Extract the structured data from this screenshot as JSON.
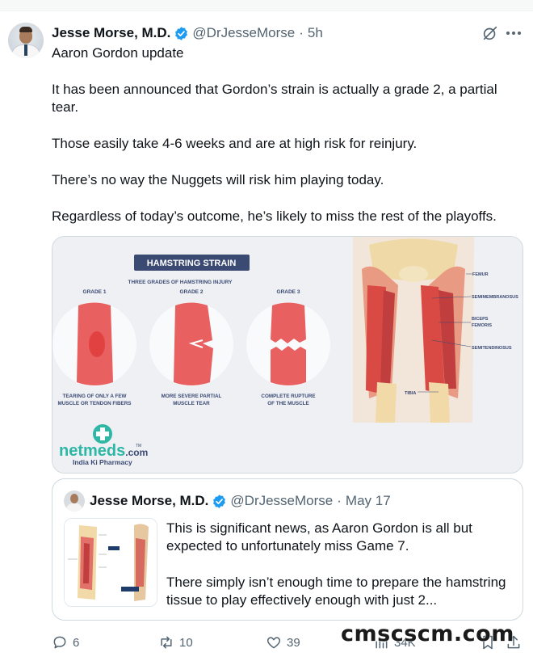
{
  "tweet": {
    "author_name": "Jesse Morse, M.D.",
    "handle": "@DrJesseMorse",
    "separator": "·",
    "time": "5h",
    "paragraphs": [
      "Aaron Gordon update",
      "It has been announced that Gordon’s strain is actually a grade 2, a partial tear.",
      "Those easily take 4-6 weeks and are at high risk for reinjury.",
      "There’s no way the Nuggets will risk him playing today.",
      "Regardless of today’s outcome, he’s likely to miss the rest of the playoffs."
    ]
  },
  "media": {
    "title": "HAMSTRING STRAIN",
    "subtitle": "THREE GRADES OF HAMSTRING INJURY",
    "grades": [
      {
        "label": "GRADE 1",
        "caption_line1": "TEARING OF ONLY A FEW",
        "caption_line2": "MUSCLE OR TENDON FIBERS"
      },
      {
        "label": "GRADE 2",
        "caption_line1": "MORE SEVERE PARTIAL",
        "caption_line2": "MUSCLE TEAR"
      },
      {
        "label": "GRADE 3",
        "caption_line1": "COMPLETE RUPTURE",
        "caption_line2": "OF THE MUSCLE"
      }
    ],
    "anatomy_labels": [
      "FEMUR",
      "SEMIMEMBRANOSUS",
      "BICEPS",
      "FEMORIS",
      "SEMITENDINOSUS",
      "TIBIA"
    ],
    "brand": "netmeds",
    "brand_suffix": ".com",
    "brand_tm": "TM",
    "tagline": "India Ki Pharmacy"
  },
  "quote": {
    "author_name": "Jesse Morse, M.D.",
    "handle": "@DrJesseMorse",
    "separator": "·",
    "date": "May 17",
    "paragraphs": [
      "This is significant news, as Aaron Gordon is all but expected to unfortunately miss Game 7.",
      "There simply isn’t enough time to prepare the hamstring tissue to play effectively enough with just 2..."
    ]
  },
  "actions": {
    "replies": "6",
    "reposts": "10",
    "likes": "39",
    "views": "34K"
  },
  "watermark": "cmscscm.com",
  "colors": {
    "verified": "#1d9bf0",
    "muted": "#536471",
    "muscle": "#e8605f",
    "brand_green": "#2fb7a6",
    "title_bg": "#3b4a73"
  },
  "icons": [
    "verified-badge-icon",
    "grok-icon",
    "more-icon",
    "reply-icon",
    "repost-icon",
    "like-icon",
    "views-icon",
    "bookmark-icon",
    "share-icon"
  ]
}
